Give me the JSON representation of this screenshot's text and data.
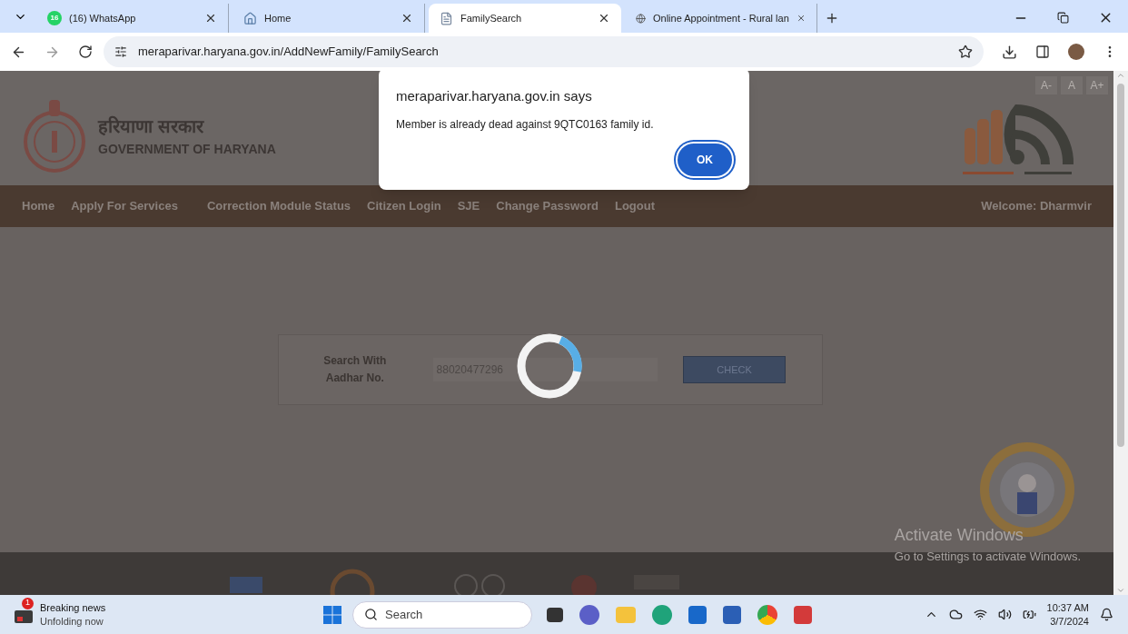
{
  "browser": {
    "tabs": [
      {
        "label": "(16) WhatsApp",
        "badge": "16",
        "kind": "whatsapp",
        "selected": false
      },
      {
        "label": "Home",
        "kind": "home",
        "selected": false
      },
      {
        "label": "FamilySearch",
        "kind": "file",
        "selected": true
      },
      {
        "label": "Online Appointment - Rural lan",
        "kind": "globe",
        "selected": false
      }
    ],
    "url": "meraparivar.haryana.gov.in/AddNewFamily/FamilySearch"
  },
  "page": {
    "font_buttons": [
      "A-",
      "A",
      "A+"
    ],
    "title_hindi": "हरियाणा सरकार",
    "title": "GOVERNMENT OF HARYANA",
    "nav": [
      "Home",
      "Apply For Services",
      "Correction Module Status",
      "Citizen Login",
      "SJE",
      "Change Password",
      "Logout"
    ],
    "welcome": "Welcome: Dharmvir",
    "search_form": {
      "label": "Search With Aadhar No.",
      "value": "88020477296",
      "button": "CHECK"
    }
  },
  "dialog": {
    "title": "meraparivar.haryana.gov.in says",
    "message": "Member is already dead against 9QTC0163 family id.",
    "button": "OK"
  },
  "activation": {
    "title": "Activate Windows",
    "message": "Go to Settings to activate Windows."
  },
  "taskbar": {
    "news_badge": "1",
    "news_title": "Breaking news",
    "news_subtitle": "Unfolding now",
    "search_placeholder": "Search",
    "time": "10:37 AM",
    "date": "3/7/2024"
  }
}
